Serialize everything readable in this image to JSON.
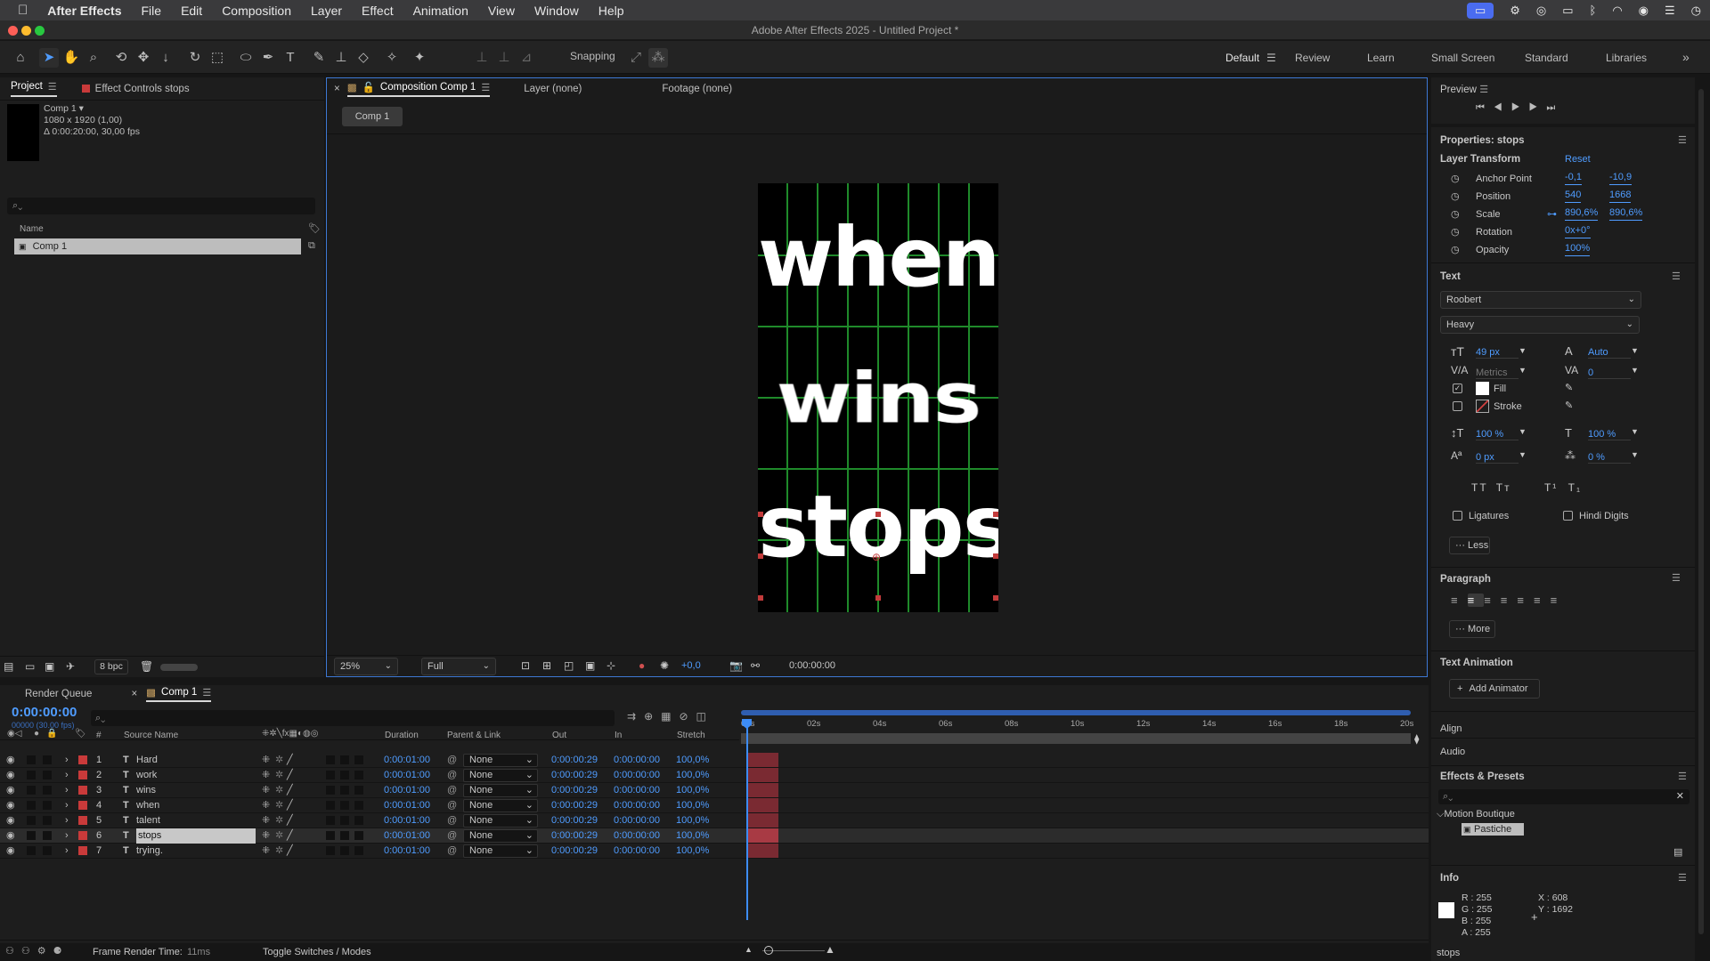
{
  "menubar": {
    "app": "After Effects",
    "items": [
      "File",
      "Edit",
      "Composition",
      "Layer",
      "Effect",
      "Animation",
      "View",
      "Window",
      "Help"
    ]
  },
  "window": {
    "title": "Adobe After Effects 2025 - Untitled Project *"
  },
  "toolbar": {
    "snapping": "Snapping",
    "workspaces": [
      "Default",
      "Review",
      "Learn",
      "Small Screen",
      "Standard",
      "Libraries"
    ]
  },
  "project": {
    "tab": "Project",
    "effect_tab": "Effect Controls stops",
    "comp_name": "Comp 1 ▾",
    "comp_size": "1080 x 1920 (1,00)",
    "comp_duration": "Δ 0:00:20:00, 30,00 fps",
    "name_header": "Name",
    "item": "Comp 1",
    "bpc": "8 bpc"
  },
  "comp": {
    "tab": "Composition Comp 1",
    "layer_tab": "Layer (none)",
    "footage_tab": "Footage (none)",
    "crumb": "Comp 1",
    "words": [
      "when",
      "wins",
      "stops"
    ],
    "zoom": "25%",
    "resolution": "Full",
    "exposure": "+0,0",
    "timecode": "0:00:00:00"
  },
  "preview": {
    "title": "Preview"
  },
  "properties": {
    "title": "Properties: stops",
    "transform": "Layer Transform",
    "reset": "Reset",
    "anchor_label": "Anchor Point",
    "anchor_x": "-0,1",
    "anchor_y": "-10,9",
    "position_label": "Position",
    "position_x": "540",
    "position_y": "1668",
    "scale_label": "Scale",
    "scale_x": "890,6%",
    "scale_y": "890,6%",
    "rotation_label": "Rotation",
    "rotation": "0x+0°",
    "opacity_label": "Opacity",
    "opacity": "100%"
  },
  "text": {
    "title": "Text",
    "font": "Roobert",
    "style": "Heavy",
    "size": "49 px",
    "leading": "Auto",
    "kerning": "Metrics",
    "tracking": "0",
    "fill": "Fill",
    "stroke": "Stroke",
    "vscale": "100 %",
    "hscale": "100 %",
    "baseline": "0 px",
    "tsume": "0 %",
    "ligatures": "Ligatures",
    "hindi": "Hindi Digits",
    "less": "Less"
  },
  "paragraph": {
    "title": "Paragraph",
    "more": "More"
  },
  "text_animation": {
    "title": "Text Animation",
    "add": "Add Animator"
  },
  "align": "Align",
  "audio": "Audio",
  "effects": {
    "title": "Effects & Presets",
    "folder": "Motion Boutique",
    "item": "Pastiche"
  },
  "info": {
    "title": "Info",
    "r": "R : 255",
    "g": "G : 255",
    "b": "B : 255",
    "a": "A : 255",
    "x": "X : 608",
    "y": "Y : 1692",
    "layer": "stops"
  },
  "timeline": {
    "render_tab": "Render Queue",
    "comp_tab": "Comp 1",
    "time": "0:00:00:00",
    "fps": "00000 (30.00 fps)",
    "headers": {
      "source": "Source Name",
      "duration": "Duration",
      "parent": "Parent & Link",
      "out": "Out",
      "in": "In",
      "stretch": "Stretch",
      "num": "#"
    },
    "ruler": [
      "00s",
      "02s",
      "04s",
      "06s",
      "08s",
      "10s",
      "12s",
      "14s",
      "16s",
      "18s",
      "20s"
    ],
    "layers": [
      {
        "num": "1",
        "name": "Hard",
        "duration": "0:00:01:00",
        "parent": "None",
        "out": "0:00:00:29",
        "in": "0:00:00:00",
        "stretch": "100,0%"
      },
      {
        "num": "2",
        "name": "work",
        "duration": "0:00:01:00",
        "parent": "None",
        "out": "0:00:00:29",
        "in": "0:00:00:00",
        "stretch": "100,0%"
      },
      {
        "num": "3",
        "name": "wins",
        "duration": "0:00:01:00",
        "parent": "None",
        "out": "0:00:00:29",
        "in": "0:00:00:00",
        "stretch": "100,0%"
      },
      {
        "num": "4",
        "name": "when",
        "duration": "0:00:01:00",
        "parent": "None",
        "out": "0:00:00:29",
        "in": "0:00:00:00",
        "stretch": "100,0%"
      },
      {
        "num": "5",
        "name": "talent",
        "duration": "0:00:01:00",
        "parent": "None",
        "out": "0:00:00:29",
        "in": "0:00:00:00",
        "stretch": "100,0%"
      },
      {
        "num": "6",
        "name": "stops",
        "duration": "0:00:01:00",
        "parent": "None",
        "out": "0:00:00:29",
        "in": "0:00:00:00",
        "stretch": "100,0%"
      },
      {
        "num": "7",
        "name": "trying.",
        "duration": "0:00:01:00",
        "parent": "None",
        "out": "0:00:00:29",
        "in": "0:00:00:00",
        "stretch": "100,0%"
      }
    ],
    "frame_render_label": "Frame Render Time:",
    "frame_render": "11ms",
    "toggle": "Toggle Switches / Modes"
  }
}
